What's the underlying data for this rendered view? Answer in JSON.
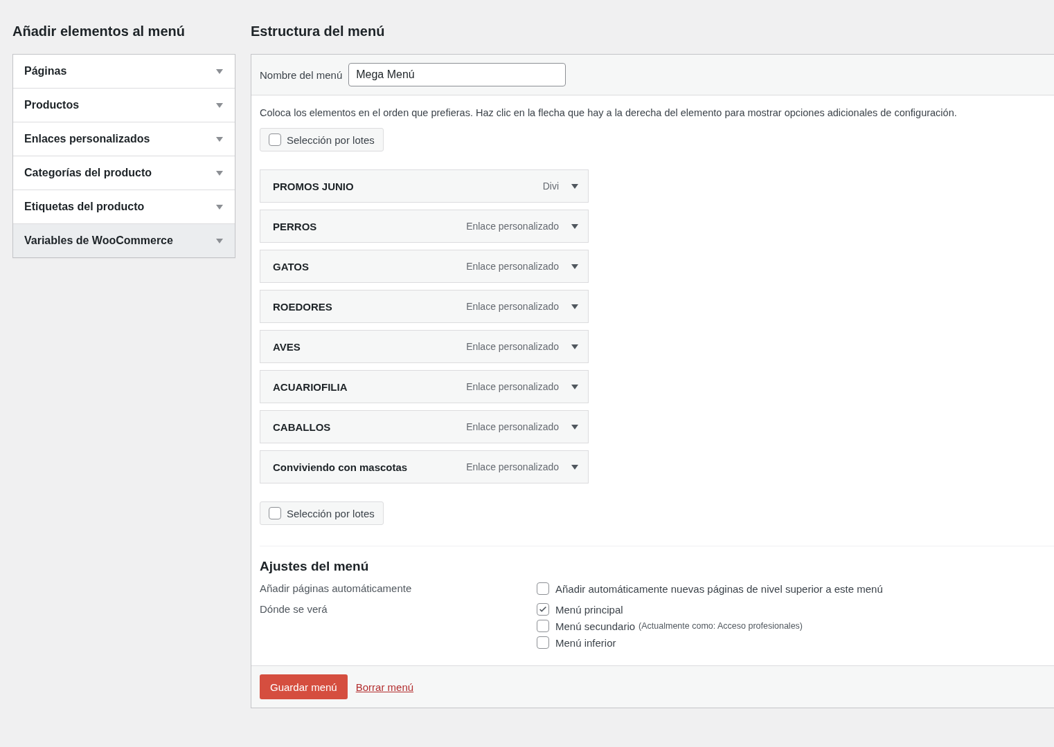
{
  "sidebar": {
    "title": "Añadir elementos al menú",
    "items": [
      {
        "label": "Páginas",
        "highlighted": false
      },
      {
        "label": "Productos",
        "highlighted": false
      },
      {
        "label": "Enlaces personalizados",
        "highlighted": false
      },
      {
        "label": "Categorías del producto",
        "highlighted": false
      },
      {
        "label": "Etiquetas del producto",
        "highlighted": false
      },
      {
        "label": "Variables de WooCommerce",
        "highlighted": true
      }
    ]
  },
  "structure": {
    "title": "Estructura del menú",
    "name_label": "Nombre del menú",
    "name_value": "Mega Menú",
    "instructions": "Coloca los elementos en el orden que prefieras. Haz clic en la flecha que hay a la derecha del elemento para mostrar opciones adicionales de configuración.",
    "bulk_top": {
      "label": "Selección por lotes",
      "checked": false
    },
    "items": [
      {
        "title": "PROMOS JUNIO",
        "type": "Divi"
      },
      {
        "title": "PERROS",
        "type": "Enlace personalizado"
      },
      {
        "title": "GATOS",
        "type": "Enlace personalizado"
      },
      {
        "title": "ROEDORES",
        "type": "Enlace personalizado"
      },
      {
        "title": "AVES",
        "type": "Enlace personalizado"
      },
      {
        "title": "ACUARIOFILIA",
        "type": "Enlace personalizado"
      },
      {
        "title": "CABALLOS",
        "type": "Enlace personalizado"
      },
      {
        "title": "Conviviendo con mascotas",
        "type": "Enlace personalizado"
      }
    ],
    "bulk_bottom": {
      "label": "Selección por lotes",
      "checked": false
    }
  },
  "settings": {
    "title": "Ajustes del menú",
    "rows": [
      {
        "label": "Añadir páginas automáticamente",
        "options": [
          {
            "label": "Añadir automáticamente nuevas páginas de nivel superior a este menú",
            "checked": false
          }
        ]
      },
      {
        "label": "Dónde se verá",
        "options": [
          {
            "label": "Menú principal",
            "checked": true
          },
          {
            "label": "Menú secundario",
            "note": "(Actualmente como: Acceso profesionales)",
            "checked": false
          },
          {
            "label": "Menú inferior",
            "checked": false
          }
        ]
      }
    ]
  },
  "footer": {
    "save": "Guardar menú",
    "delete": "Borrar menú"
  }
}
